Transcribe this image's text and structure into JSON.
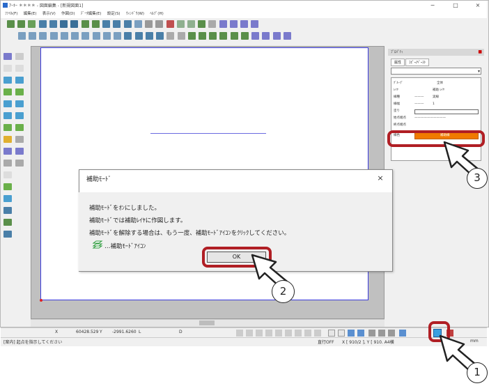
{
  "window": {
    "title": "ｱｰｷｰ ＊＊＊＊ - 図面編集 - [新規図面1]",
    "minimize": "−",
    "maximize": "□",
    "close": "×"
  },
  "menubar": {
    "items": [
      "ﾌｧｲﾙ(F)",
      "編集(E)",
      "表示(V)",
      "作図(D)",
      "ﾃﾞｰﾀ編集(E)",
      "設定(S)",
      "ｳｨﾝﾄﾞｳ(W)",
      "ﾍﾙﾌﾟ(H)"
    ]
  },
  "right_panel": {
    "title": "ﾌﾟﾛﾊﾟﾃｨ",
    "tabs": [
      "属性",
      "ｺﾋﾟｰ/ﾍﾟｰｽﾄ"
    ],
    "properties": [
      {
        "label": "ｸﾞﾙｰﾌﾟ",
        "value": "全体"
      },
      {
        "label": "ﾚｲﾔ",
        "value": "補助 ﾚｲﾔ"
      },
      {
        "label": "線種",
        "value": "実線"
      },
      {
        "label": "線幅",
        "value": "1"
      },
      {
        "label": "塗り",
        "value": ""
      },
      {
        "label": "始点端点",
        "value": ""
      },
      {
        "label": "終点端点",
        "value": ""
      },
      {
        "label": "線色",
        "value": "補助線"
      }
    ]
  },
  "dialog": {
    "title": "補助ﾓｰﾄﾞ",
    "close": "×",
    "line1": "補助ﾓｰﾄﾞをｵﾝにしました。",
    "line2": "補助ﾓｰﾄﾞでは補助ﾚｲﾔに作図します。",
    "line3": "補助ﾓｰﾄﾞを解除する場合は、もう一度、補助ﾓｰﾄﾞｱｲｺﾝをｸﾘｯｸしてください。",
    "line4": "…補助ﾓｰﾄﾞｱｲｺﾝ",
    "ok": "OK"
  },
  "status": {
    "x_label": "X",
    "x_value": "60428.529",
    "y_label": "Y",
    "y_value": "-2991.6260",
    "l_label": "L",
    "d_label": "D",
    "message": "[案内] 起点を指示してください",
    "snap": "直行OFF",
    "coords": "X [ 910/2 ], Y [ 910. A4横",
    "unit": "mm"
  },
  "callouts": {
    "c1": "1",
    "c2": "2",
    "c3": "3"
  },
  "colors": {
    "accent_red": "#b01e24",
    "line_orange": "#f07a00",
    "paper_border": "#3a3adc"
  }
}
